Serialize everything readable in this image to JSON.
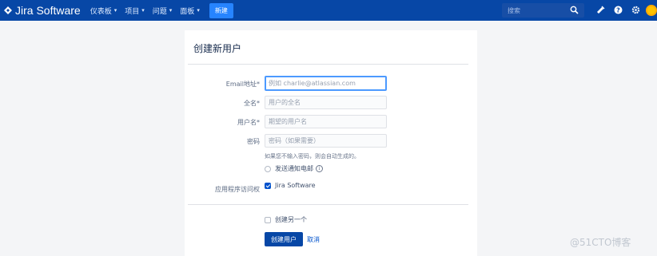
{
  "header": {
    "product_name": "Jira Software",
    "nav": [
      {
        "label": "仪表板"
      },
      {
        "label": "项目"
      },
      {
        "label": "问题"
      },
      {
        "label": "面板"
      }
    ],
    "create_label": "新建",
    "search_placeholder": "搜索"
  },
  "form": {
    "title": "创建新用户",
    "email": {
      "label": "Email地址*",
      "placeholder": "例如 charlie@atlassian.com"
    },
    "fullname": {
      "label": "全名*",
      "placeholder": "用户的全名"
    },
    "username": {
      "label": "用户名*",
      "placeholder": "期望的用户名"
    },
    "password": {
      "label": "密码",
      "placeholder": "密码（如果需要）",
      "hint": "如果您不输入密码，则会自动生成的。"
    },
    "notify_label": "发送通知电邮",
    "app_access_label": "应用程序访问权",
    "app_access_item": "Jira Software",
    "create_another_label": "创建另一个",
    "submit_label": "创建用户",
    "cancel_label": "取消"
  },
  "watermark": "@51CTO博客",
  "colors": {
    "topbar": "#0747a6",
    "accent": "#0052cc",
    "focus": "#4c9aff"
  }
}
